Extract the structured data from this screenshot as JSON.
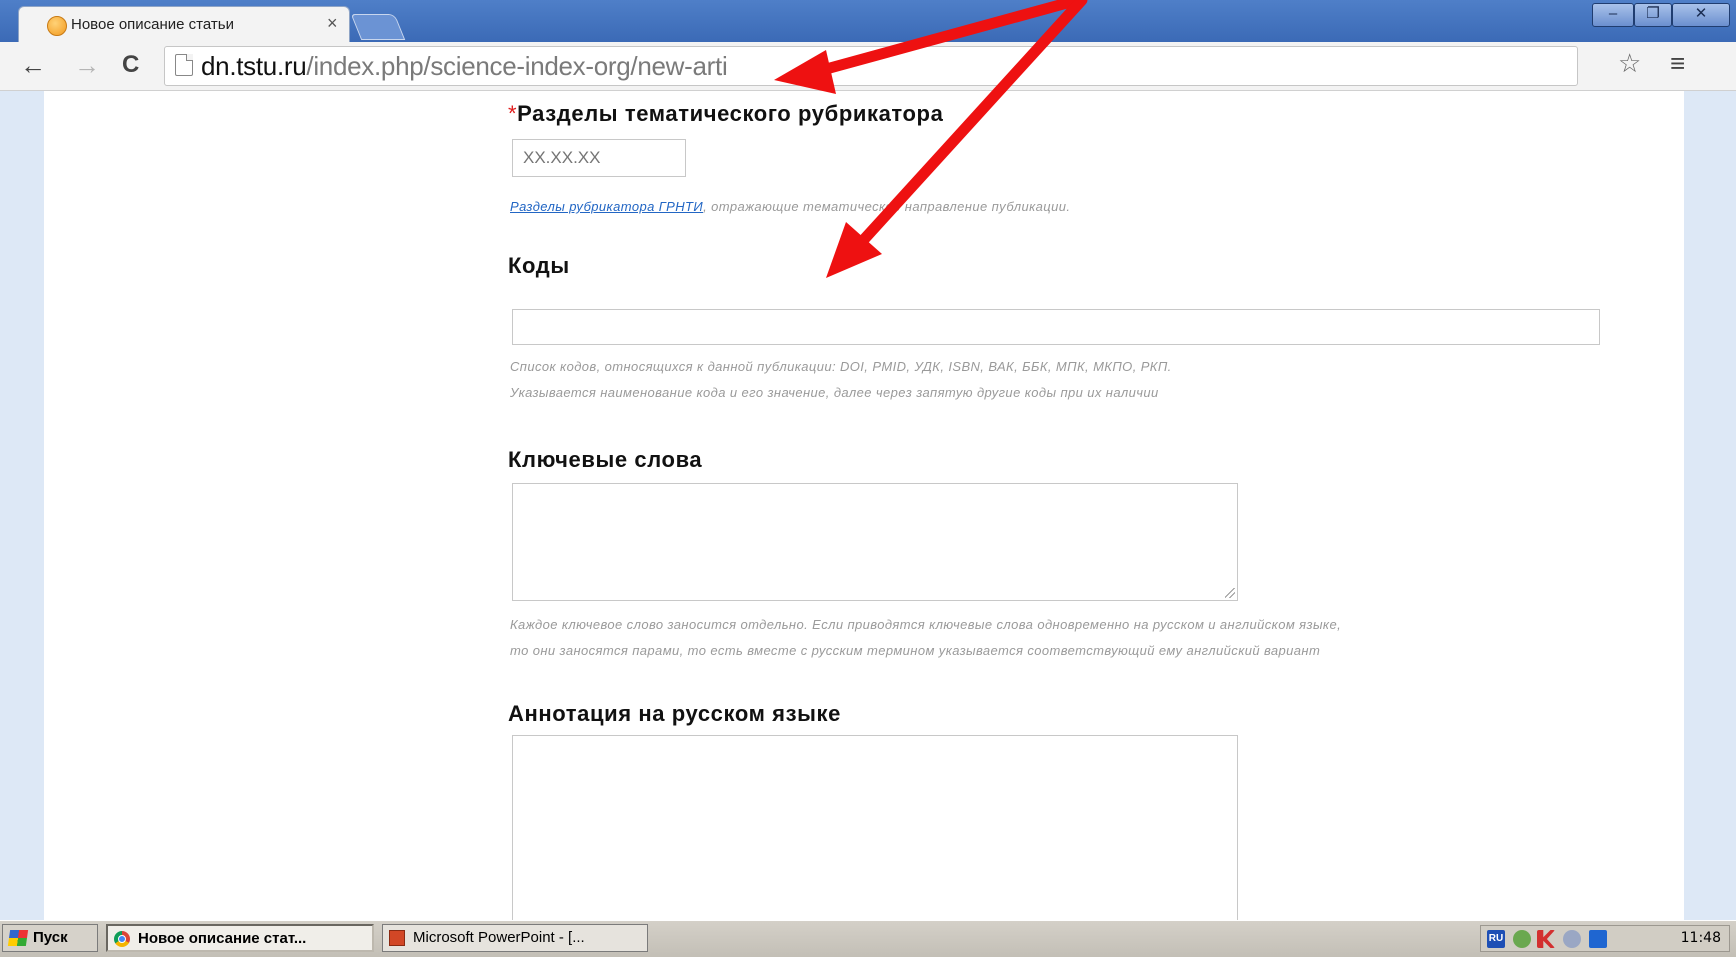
{
  "tab": {
    "title": "Новое описание статьи",
    "close": "×"
  },
  "window": {
    "minimize": "–",
    "restore": "❐",
    "close": "✕"
  },
  "toolbar": {
    "back": "←",
    "forward": "→",
    "reload": "C",
    "url_domain": "dn.tstu.ru",
    "url_path": "/index.php/science-index-org/new-arti",
    "star": "☆",
    "menu": "≡"
  },
  "form": {
    "rubrics": {
      "required_mark": "*",
      "label": "Разделы тематического рубрикатора",
      "placeholder": "XX.XX.XX",
      "hint_link": "Разделы рубрикатора ГРНТИ",
      "hint_text": ", отражающие тематическое направление публикации."
    },
    "codes": {
      "label": "Коды",
      "hint_line1": "Список кодов, относящихся к данной публикации: DOI, PMID, УДК, ISBN, ВАК, ББК, МПК, МКПО, РКП.",
      "hint_line2": "Указывается наименование кода и его значение, далее через запятую другие коды при их наличии"
    },
    "keywords": {
      "label": "Ключевые слова",
      "hint_line1": "Каждое ключевое слово заносится отдельно. Если приводятся ключевые слова одновременно на русском и английском языке,",
      "hint_line2": "то они заносятся парами, то есть вместе с русским термином указывается соответствующий ему английский вариант"
    },
    "abstract_ru": {
      "label": "Аннотация на русском языке"
    }
  },
  "taskbar": {
    "start": "Пуск",
    "chrome_task": "Новое описание стат...",
    "ppt_task": "Microsoft PowerPoint - [...",
    "lang": "RU",
    "clock": "11:48"
  },
  "colors": {
    "annotation_arrow": "#ee1111",
    "link": "#2266c4",
    "required": "#e01b1b"
  }
}
